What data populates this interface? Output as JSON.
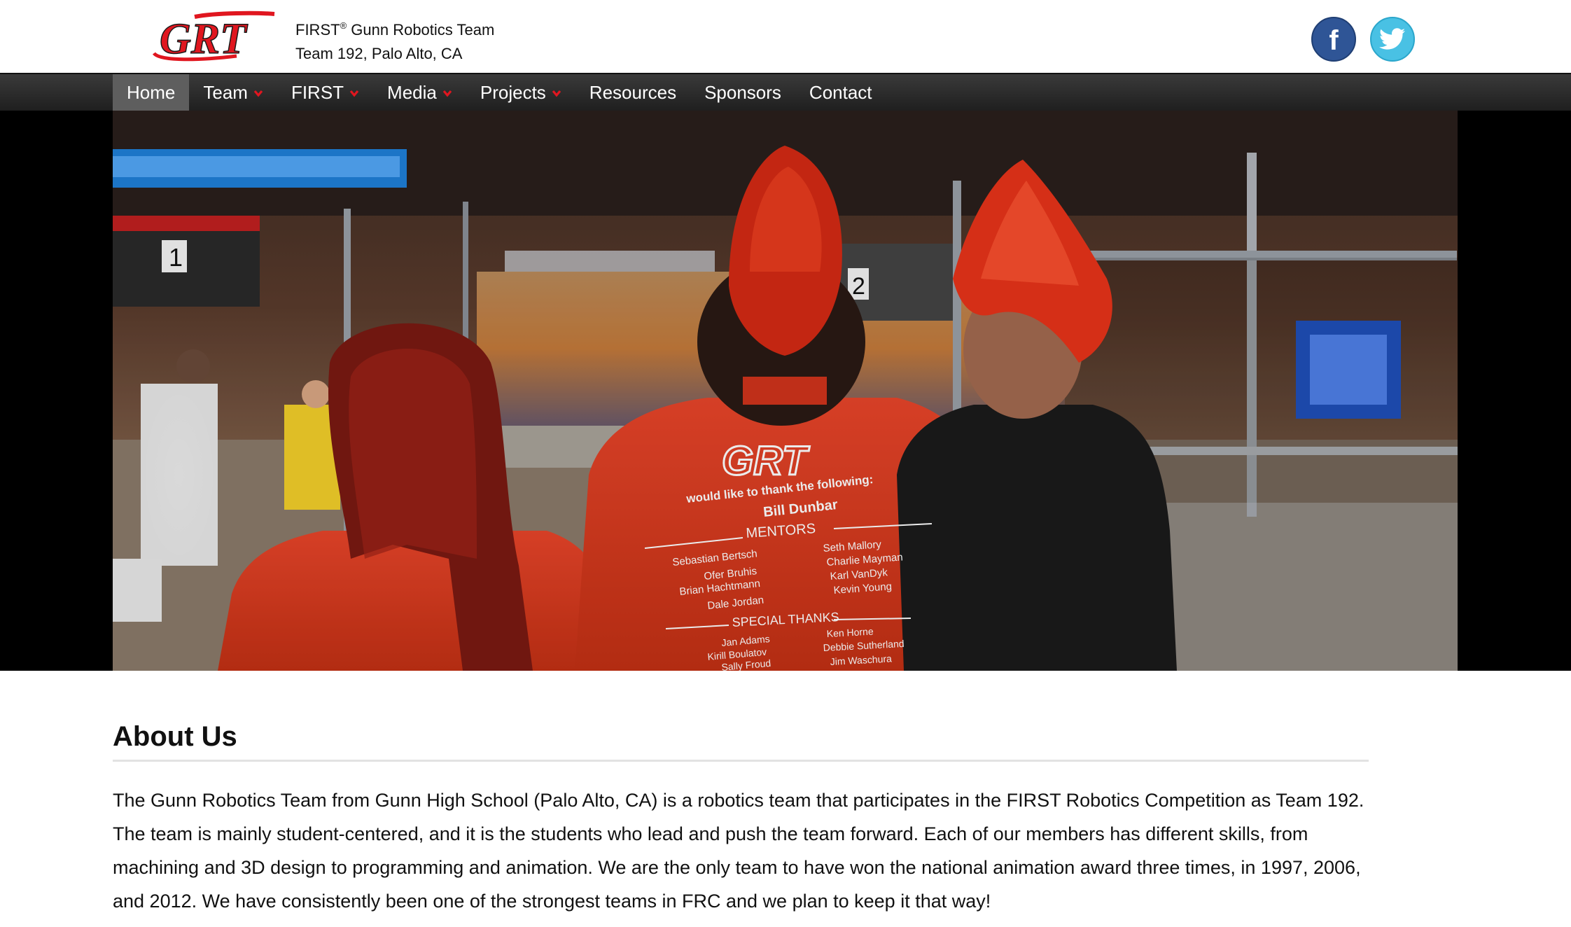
{
  "header": {
    "logo_text": "GRT",
    "first_word": "FIRST",
    "registered": "®",
    "team_name_rest": " Gunn Robotics Team",
    "team_location": "Team 192, Palo Alto, CA",
    "facebook_glyph": "f",
    "facebook_icon": "facebook-icon",
    "twitter_icon": "twitter-bird-icon"
  },
  "nav": {
    "items": [
      {
        "label": "Home",
        "active": true,
        "dropdown": false
      },
      {
        "label": "Team",
        "active": false,
        "dropdown": true
      },
      {
        "label": "FIRST",
        "active": false,
        "dropdown": true
      },
      {
        "label": "Media",
        "active": false,
        "dropdown": true
      },
      {
        "label": "Projects",
        "active": false,
        "dropdown": true
      },
      {
        "label": "Resources",
        "active": false,
        "dropdown": false
      },
      {
        "label": "Sponsors",
        "active": false,
        "dropdown": false
      },
      {
        "label": "Contact",
        "active": false,
        "dropdown": false
      }
    ]
  },
  "hero": {
    "shirt_logo": "GRT",
    "shirt_thanks": "would like to thank the following:",
    "shirt_name": "Bill Dunbar",
    "shirt_mentors": "MENTORS",
    "shirt_special": "SPECIAL THANKS",
    "mentors_left": [
      "Sebastian Bertsch",
      "Ofer Bruhis",
      "Brian Hachtmann",
      "Dale Jordan"
    ],
    "mentors_right": [
      "Seth Mallory",
      "Charlie Mayman",
      "Karl VanDyk",
      "Kevin Young"
    ],
    "special_left": [
      "Jan Adams",
      "Kirill Boulatov",
      "Sally Froud"
    ],
    "special_right": [
      "Ken Horne",
      "Debbie Sutherland",
      "Jim Waschura"
    ],
    "sign_1": "1",
    "sign_2": "2"
  },
  "about": {
    "title": "About Us",
    "body": "The Gunn Robotics Team from Gunn High School (Palo Alto, CA) is a robotics team that participates in the FIRST Robotics Competition as Team 192. The team is mainly student-centered, and it is the students who lead and push the team forward. Each of our members has different skills, from machining and 3D design to programming and animation. We are the only team to have won the national animation award three times, in 1997, 2006, and 2012. We have consistently been one of the strongest teams in FRC and we plan to keep it that way!"
  },
  "colors": {
    "accent_red": "#e0161f",
    "nav_bg": "#2b2b2b",
    "nav_active": "#5e5e5e",
    "facebook_blue": "#2f5596",
    "twitter_blue": "#49c1e4"
  }
}
